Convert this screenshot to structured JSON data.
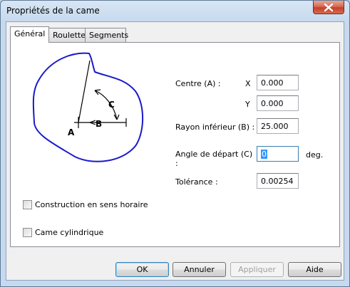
{
  "window": {
    "title": "Propriétés de la came"
  },
  "tabs": [
    {
      "label": "Général",
      "active": true
    },
    {
      "label": "Roulette",
      "active": false
    },
    {
      "label": "Segments",
      "active": false
    }
  ],
  "diagram": {
    "label_a": "A",
    "label_b": "B",
    "label_c": "C",
    "curve_color": "#1a1acc"
  },
  "fields": {
    "centre_label": "Centre (A) :",
    "x_label": "X",
    "x_value": "0.000",
    "y_label": "Y",
    "y_value": "0.000",
    "rayon_label": "Rayon inférieur (B) :",
    "rayon_value": "25.000",
    "angle_label_line1": "Angle de départ (C)",
    "angle_label_line2": ":",
    "angle_value": "0",
    "angle_unit": "deg.",
    "tolerance_label": "Tolérance :",
    "tolerance_value": "0.00254"
  },
  "checkboxes": [
    {
      "label": "Construction en sens horaire",
      "checked": false
    },
    {
      "label": "Came cylindrique",
      "checked": false
    }
  ],
  "buttons": {
    "ok": "OK",
    "cancel": "Annuler",
    "apply": "Appliquer",
    "help": "Aide"
  }
}
